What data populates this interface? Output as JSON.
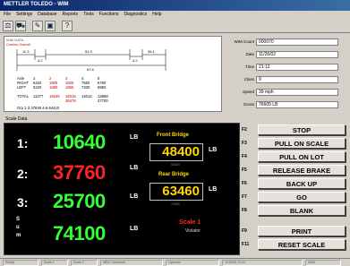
{
  "window": {
    "title": "METTLER TOLEDO - WIM"
  },
  "menu": [
    "File",
    "Settings",
    "Database",
    "Reports",
    "Tools",
    "Functions",
    "Diagnostics",
    "Help"
  ],
  "toolbar": {
    "icons": [
      "scale-icon",
      "truck-icon",
      "edit-icon",
      "camera-icon",
      "help-icon"
    ]
  },
  "wim": {
    "title": "WIM DATA",
    "subtitle": "Combo Overall",
    "dims": [
      "11.3",
      "4.2",
      "51.9",
      "35.1",
      "4.2",
      "67.6"
    ],
    "axle_header": [
      "Axle",
      "1",
      "2",
      "3",
      "4",
      "5"
    ],
    "right_row": [
      "RIGHT",
      "5420",
      "1905",
      "1825",
      "7560",
      "6780"
    ],
    "left_row": [
      "LEFT",
      "5220",
      "1880",
      "1855",
      "7330",
      "6960"
    ],
    "total_row": [
      "TOTAL",
      "11377",
      "18155",
      "18316",
      "14012",
      "13688"
    ],
    "total_sub": [
      "",
      "",
      "",
      "36476",
      "",
      "27700"
    ],
    "grp_row": "Grp 1-3  37849  4-6  64410"
  },
  "fields": [
    {
      "label": "WIM Count",
      "value": "000070"
    },
    {
      "label": "Date",
      "value": "11/26/02"
    },
    {
      "label": "Time",
      "value": "21:12"
    },
    {
      "label": "Class",
      "value": "9"
    },
    {
      "label": "Speed",
      "value": "39 mph"
    },
    {
      "label": "Gross",
      "value": "76605 LB"
    }
  ],
  "scale": {
    "label": "Scale Data",
    "rows": [
      {
        "label": "1:",
        "value": "10640",
        "unit": "LB",
        "color": "#33ff33"
      },
      {
        "label": "2:",
        "value": "37760",
        "unit": "LB",
        "color": "#ff2222"
      },
      {
        "label": "3:",
        "value": "25700",
        "unit": "LB",
        "color": "#33ff33"
      }
    ],
    "sum": {
      "letters": [
        "S",
        "u",
        "m"
      ],
      "value": "74100",
      "unit": "LB"
    },
    "front": {
      "label": "Front Bridge",
      "value": "48400",
      "unit": "LB",
      "sub": "51600"
    },
    "rear": {
      "label": "Rear Bridge",
      "value": "63460",
      "unit": "LB",
      "sub": "70000"
    },
    "status": "Scale 1",
    "status_sub": "Violator"
  },
  "fkeys": [
    {
      "key": "F2",
      "label": "STOP"
    },
    {
      "key": "F3",
      "label": "PULL ON SCALE"
    },
    {
      "key": "F4",
      "label": "PULL ON LOT"
    },
    {
      "key": "F5",
      "label": "RELEASE BRAKE"
    },
    {
      "key": "F6",
      "label": "BACK UP"
    },
    {
      "key": "F7",
      "label": "GO"
    },
    {
      "key": "F8",
      "label": "BLANK"
    },
    {
      "key": "F9",
      "label": "PRINT"
    },
    {
      "key": "F11",
      "label": "RESET SCALE"
    }
  ],
  "statusbar": [
    "Ready",
    "Scale 1",
    "Scale 2",
    "WIM Connected",
    "Operator",
    "11/26/02 21:12",
    "NUM"
  ]
}
